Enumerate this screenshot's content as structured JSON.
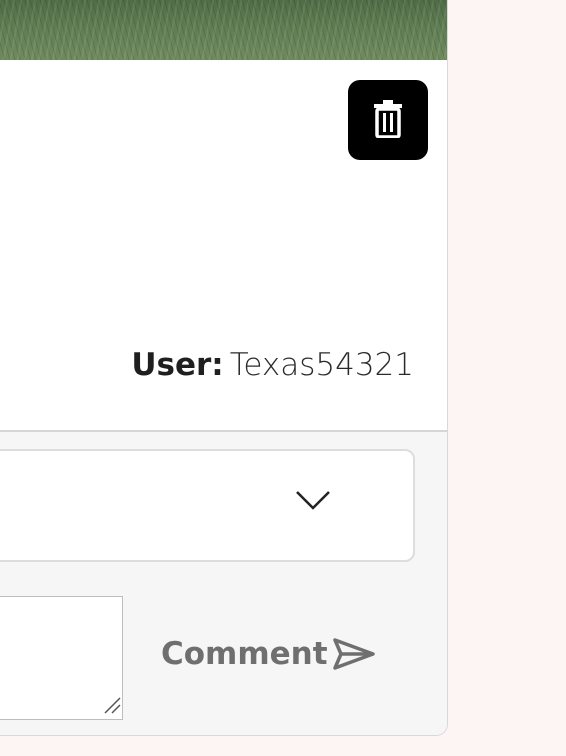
{
  "post": {
    "photo_alt": "grass photo",
    "user_label": "User:",
    "user_name": "Texas54321"
  },
  "actions": {
    "delete_icon": "trash-icon"
  },
  "comment_form": {
    "select_value": "",
    "textarea_value": "",
    "comment_label": "Comment",
    "send_icon": "send-icon"
  },
  "colors": {
    "page_bg": "#fdf5f4",
    "card_bg": "#ffffff",
    "delete_btn_bg": "#000000",
    "form_bg": "#f6f6f6",
    "comment_text": "#6f6f6f"
  }
}
